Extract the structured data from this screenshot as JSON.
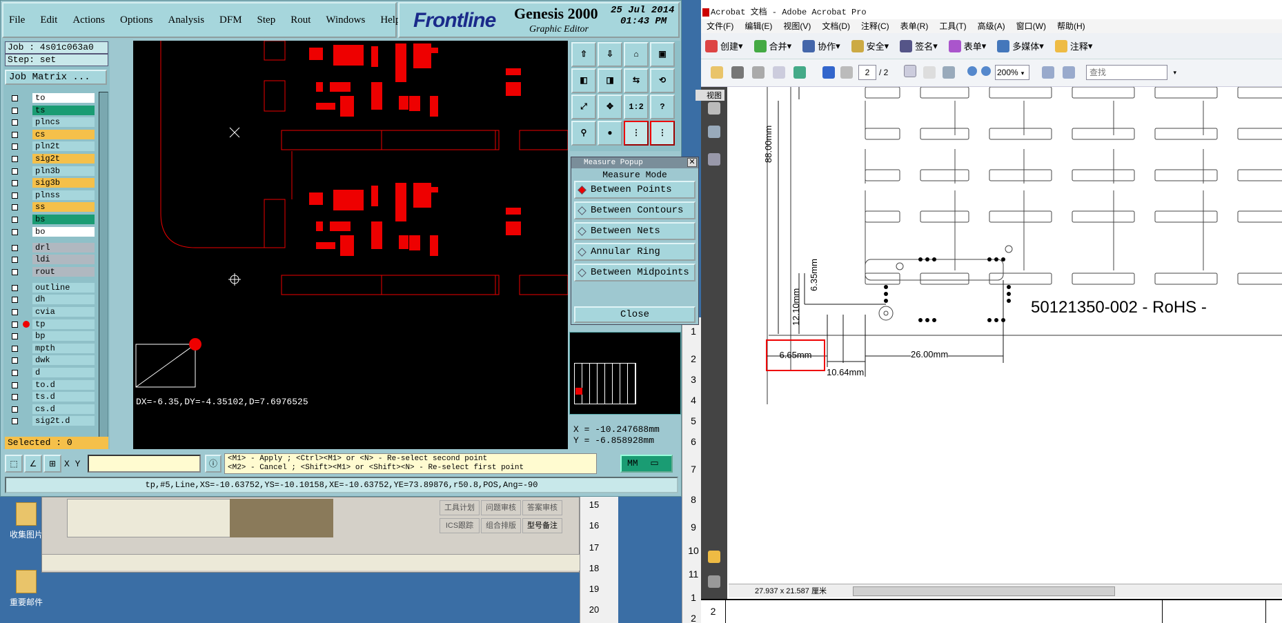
{
  "genesis": {
    "menu": [
      "File",
      "Edit",
      "Actions",
      "Options",
      "Analysis",
      "DFM",
      "Step",
      "Rout",
      "Windows",
      "Help"
    ],
    "brand": "Frontline",
    "product": "Genesis 2000",
    "subtitle": "Graphic Editor",
    "date": "25 Jul 2014",
    "time": "01:43 PM",
    "job": "Job : 4s01c063a0",
    "step": "Step: set",
    "job_matrix_button": "Job Matrix ...",
    "layers": [
      {
        "name": "to",
        "color": "#ffffff"
      },
      {
        "name": "ts",
        "color": "#1a9c73"
      },
      {
        "name": "plncs",
        "color": "#a6d6dc"
      },
      {
        "name": "cs",
        "color": "#f5c04a"
      },
      {
        "name": "pln2t",
        "color": "#a6d6dc"
      },
      {
        "name": "sig2t",
        "color": "#f5c04a"
      },
      {
        "name": "pln3b",
        "color": "#a6d6dc"
      },
      {
        "name": "sig3b",
        "color": "#f5c04a"
      },
      {
        "name": "plnss",
        "color": "#a6d6dc"
      },
      {
        "name": "ss",
        "color": "#f5c04a"
      },
      {
        "name": "bs",
        "color": "#1a9c73"
      },
      {
        "name": "bo",
        "color": "#ffffff"
      },
      {
        "name": "drl",
        "color": "#b0b8c0"
      },
      {
        "name": "ldi",
        "color": "#b0b8c0"
      },
      {
        "name": "rout",
        "color": "#b0b8c0"
      },
      {
        "name": "outline",
        "color": "#a6d6dc"
      },
      {
        "name": "dh",
        "color": "#a6d6dc"
      },
      {
        "name": "cvia",
        "color": "#a6d6dc"
      },
      {
        "name": "tp",
        "color": "#a6d6dc"
      },
      {
        "name": "bp",
        "color": "#a6d6dc"
      },
      {
        "name": "mpth",
        "color": "#a6d6dc"
      },
      {
        "name": "dwk",
        "color": "#a6d6dc"
      },
      {
        "name": "d",
        "color": "#a6d6dc"
      },
      {
        "name": "to.d",
        "color": "#a6d6dc"
      },
      {
        "name": "ts.d",
        "color": "#a6d6dc"
      },
      {
        "name": "cs.d",
        "color": "#a6d6dc"
      },
      {
        "name": "sig2t.d",
        "color": "#a6d6dc"
      }
    ],
    "selected": "Selected : 0",
    "measure_readout": "DX=-6.35,DY=-4.35102,D=7.6976525",
    "xy_label": "X Y :",
    "hint_line1": "<M1> - Apply  ; <Ctrl><M1> or <N> - Re-select second point",
    "hint_line2": "<M2> - Cancel ; <Shift><M1> or <Shift><N> - Re-select first point",
    "units": "MM",
    "status": "tp,#5,Line,XS=-10.63752,YS=-10.10158,XE=-10.63752,YE=73.89876,r50.8,POS,Ang=-90",
    "coord_x": "X = -10.247688mm",
    "coord_y": "Y = -6.858928mm",
    "toolbar_labels": [
      "1:2",
      "?"
    ]
  },
  "measure_popup": {
    "title": "Measure Popup",
    "header": "Measure Mode",
    "options": [
      "Between Points",
      "Between Contours",
      "Between Nets",
      "Annular Ring",
      "Between Midpoints"
    ],
    "close": "Close"
  },
  "behind": {
    "row_numbers": [
      "1",
      "2",
      "3",
      "4",
      "5",
      "6",
      "7",
      "8",
      "9",
      "10",
      "11",
      "1",
      "2"
    ],
    "left_numbers": [
      "15",
      "16",
      "17",
      "18",
      "19",
      "20"
    ],
    "buttons": [
      "工具计划",
      "问题审核",
      "答案审核",
      "ICS跟踪",
      "组合排版",
      "型号备注"
    ],
    "desk_icons": [
      "收集图片",
      "重要邮件"
    ]
  },
  "acrobat": {
    "title": "Acrobat 文档 - Adobe Acrobat Pro",
    "menu": [
      "文件(F)",
      "编辑(E)",
      "视图(V)",
      "文档(D)",
      "注释(C)",
      "表单(R)",
      "工具(T)",
      "高级(A)",
      "窗口(W)",
      "帮助(H)"
    ],
    "toolbar": [
      "创建",
      "合并",
      "协作",
      "安全",
      "签名",
      "表单",
      "多媒体",
      "注释"
    ],
    "page_current": "2",
    "page_total": "/ 2",
    "zoom": "200%",
    "search_placeholder": "查找",
    "side_tab": "视图",
    "dimensions": {
      "d88": "88.00mm",
      "d635": "6.35mm",
      "d1210": "12.10mm",
      "d665": "6.65mm",
      "d1064": "10.64mm",
      "d26": "26.00mm"
    },
    "part_label": "50121350-002 - RoHS -",
    "status_size": "27.937 x 21.587 厘米"
  }
}
